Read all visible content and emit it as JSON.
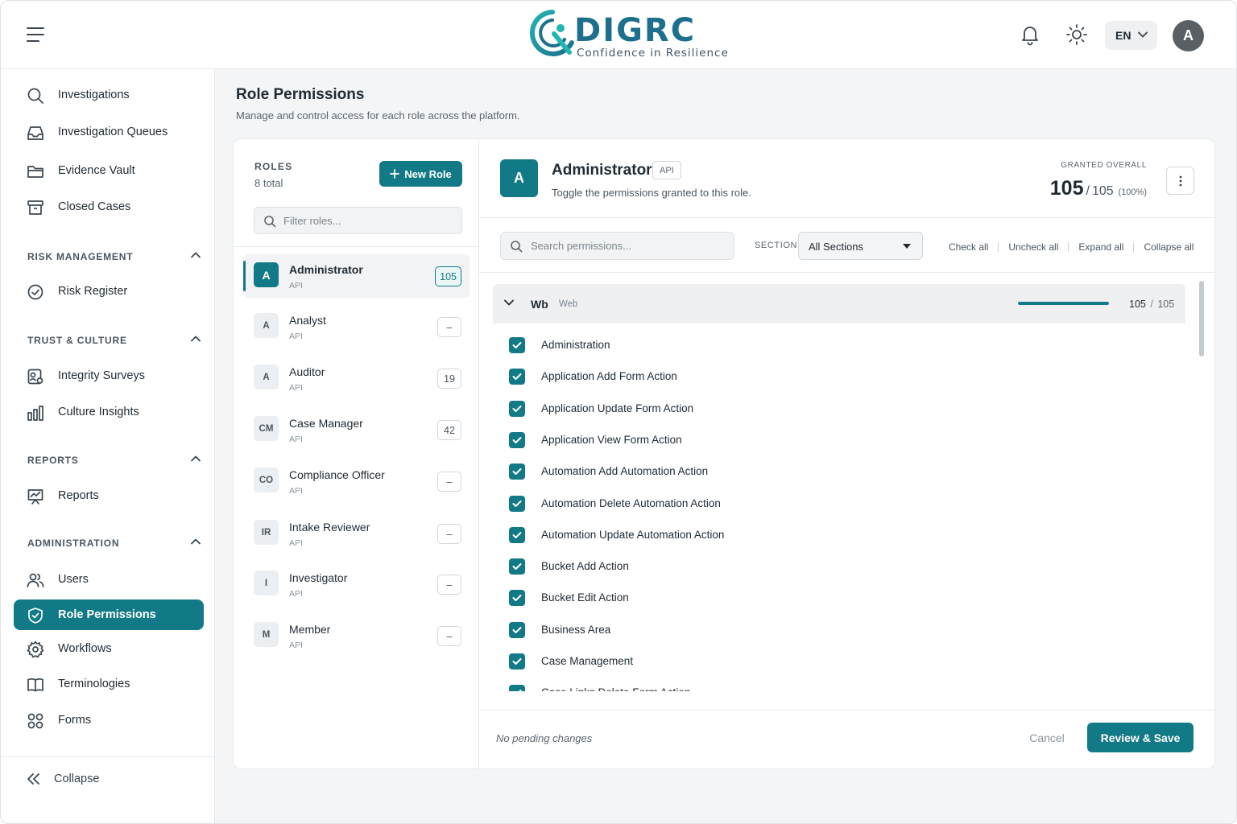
{
  "header": {
    "logo_word": "DIGRC",
    "logo_tagline": "Confidence in Resilience",
    "language": "EN",
    "avatar_initial": "A",
    "icons": [
      "menu-icon",
      "bell-icon",
      "sun-icon",
      "chevron-down-icon"
    ]
  },
  "sidebar": {
    "top_items": [
      {
        "label": "Investigations",
        "icon": "search-icon"
      },
      {
        "label": "Investigation Queues",
        "icon": "inbox-icon"
      },
      {
        "label": "Evidence Vault",
        "icon": "folder-icon"
      },
      {
        "label": "Closed Cases",
        "icon": "archive-icon"
      }
    ],
    "sections": [
      {
        "title": "RISK MANAGEMENT",
        "items": [
          {
            "label": "Risk Register",
            "icon": "check-circle-icon"
          }
        ]
      },
      {
        "title": "TRUST & CULTURE",
        "items": [
          {
            "label": "Integrity Surveys",
            "icon": "survey-icon"
          },
          {
            "label": "Culture Insights",
            "icon": "bar-chart-icon"
          }
        ]
      },
      {
        "title": "REPORTS",
        "items": [
          {
            "label": "Reports",
            "icon": "presentation-chart-icon"
          }
        ]
      },
      {
        "title": "ADMINISTRATION",
        "items": [
          {
            "label": "Users",
            "icon": "users-icon"
          },
          {
            "label": "Role Permissions",
            "icon": "shield-icon",
            "active": true
          },
          {
            "label": "Workflows",
            "icon": "gear-icon"
          },
          {
            "label": "Terminologies",
            "icon": "book-icon"
          },
          {
            "label": "Forms",
            "icon": "grid-icon"
          }
        ]
      }
    ],
    "collapse_label": "Collapse"
  },
  "page": {
    "title": "Role Permissions",
    "subtitle": "Manage and control access for each role across the platform."
  },
  "roles": {
    "heading": "ROLES",
    "count_label": "8 total",
    "new_role_label": "New Role",
    "filter_placeholder": "Filter roles...",
    "items": [
      {
        "initials": "A",
        "name": "Administrator",
        "tag": "API",
        "count": "105",
        "selected": true
      },
      {
        "initials": "A",
        "name": "Analyst",
        "tag": "API",
        "count": "–"
      },
      {
        "initials": "A",
        "name": "Auditor",
        "tag": "API",
        "count": "19"
      },
      {
        "initials": "CM",
        "name": "Case Manager",
        "tag": "API",
        "count": "42"
      },
      {
        "initials": "CO",
        "name": "Compliance Officer",
        "tag": "API",
        "count": "–"
      },
      {
        "initials": "IR",
        "name": "Intake Reviewer",
        "tag": "API",
        "count": "–"
      },
      {
        "initials": "I",
        "name": "Investigator",
        "tag": "API",
        "count": "–"
      },
      {
        "initials": "M",
        "name": "Member",
        "tag": "API",
        "count": "–"
      }
    ]
  },
  "detail": {
    "initial": "A",
    "name": "Administrator",
    "tag": "API",
    "subtitle": "Toggle the permissions granted to this role.",
    "granted_label": "GRANTED OVERALL",
    "granted_value": "105",
    "granted_sep": "/",
    "granted_total": "105",
    "granted_pct": "(100%)",
    "search_placeholder": "Search permissions...",
    "section_label": "SECTION",
    "section_value": "All Sections",
    "actions": [
      "Check all",
      "Uncheck all",
      "Expand all",
      "Collapse all"
    ],
    "group": {
      "code": "Wb",
      "name": "Web",
      "granted": "105",
      "sep": "/",
      "total": "105",
      "progress": 1.0
    },
    "permissions": [
      "Administration",
      "Application Add Form Action",
      "Application Update Form Action",
      "Application View Form Action",
      "Automation Add Automation Action",
      "Automation Delete Automation Action",
      "Automation Update Automation Action",
      "Bucket Add Action",
      "Bucket Edit Action",
      "Business Area",
      "Case Management",
      "Case Links Delete Form Action"
    ],
    "pending_label": "No pending changes",
    "cancel_label": "Cancel",
    "save_label": "Review & Save"
  },
  "colors": {
    "accent": "#127a86",
    "text": "#1f2a33",
    "muted": "#5a666f",
    "border": "#e6e9eb"
  }
}
